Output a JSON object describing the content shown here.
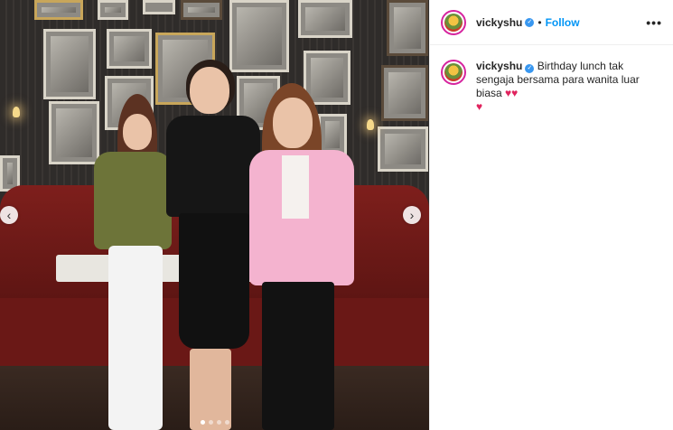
{
  "post": {
    "username": "vickyshu",
    "separator": "•",
    "follow_label": "Follow",
    "more_label": "•••",
    "caption": {
      "username": "vickyshu",
      "text": "Birthday lunch tak sengaja bersama para wanita luar biasa",
      "hearts": [
        "♥",
        "♥",
        "♥"
      ]
    }
  },
  "media": {
    "prev_label": "‹",
    "next_label": "›",
    "carousel": {
      "count": 4,
      "active_index": 0
    }
  },
  "colors": {
    "accent": "#0095f6",
    "verified": "#3897f0",
    "heart": "#e0245e"
  },
  "icons": [
    "verified-badge-icon",
    "chevron-left-icon",
    "chevron-right-icon",
    "more-options-icon",
    "heart-icon"
  ]
}
